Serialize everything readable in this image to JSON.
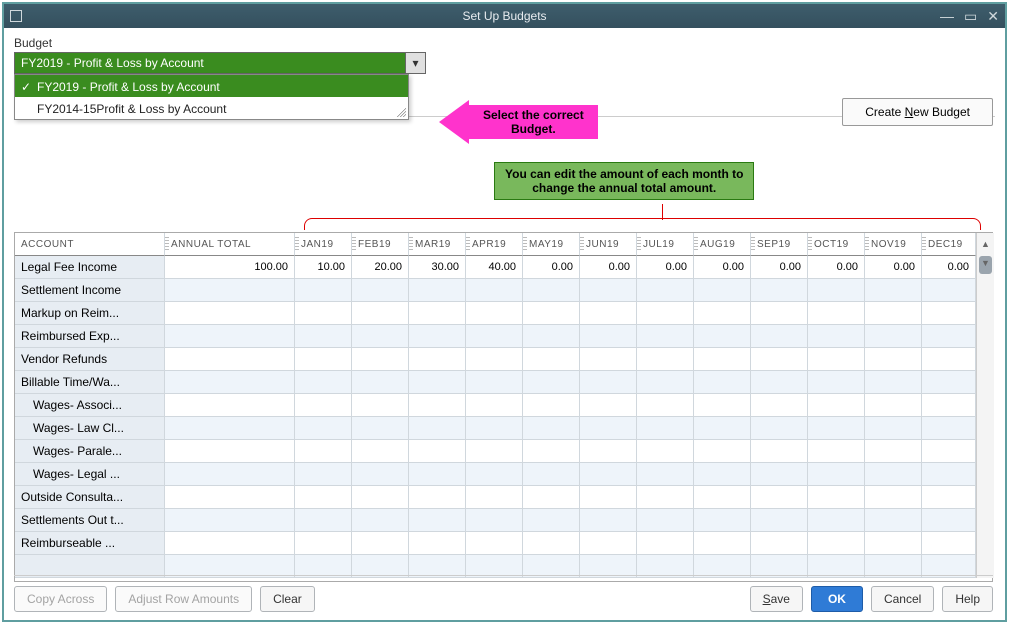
{
  "window": {
    "title": "Set Up Budgets"
  },
  "budget": {
    "label": "Budget",
    "selected": "FY2019 - Profit & Loss by Account",
    "options": [
      {
        "label": "FY2019 - Profit & Loss by Account",
        "selected": true
      },
      {
        "label": "FY2014-15Profit & Loss by Account",
        "selected": false
      }
    ]
  },
  "annotations": {
    "arrow_text": "Select the correct\nBudget.",
    "callout_text": "You can edit the amount of each month to\nchange the annual total amount."
  },
  "buttons": {
    "create_new_budget": "Create New Budget",
    "copy_across": "Copy Across",
    "adjust_row": "Adjust Row Amounts",
    "clear": "Clear",
    "save": "Save",
    "ok": "OK",
    "cancel": "Cancel",
    "help": "Help"
  },
  "grid": {
    "columns": [
      "ACCOUNT",
      "ANNUAL TOTAL",
      "JAN19",
      "FEB19",
      "MAR19",
      "APR19",
      "MAY19",
      "JUN19",
      "JUL19",
      "AUG19",
      "SEP19",
      "OCT19",
      "NOV19",
      "DEC19"
    ],
    "rows": [
      {
        "name": "Legal Fee Income",
        "annual": "100.00",
        "vals": [
          "10.00",
          "20.00",
          "30.00",
          "40.00",
          "0.00",
          "0.00",
          "0.00",
          "0.00",
          "0.00",
          "0.00",
          "0.00",
          "0.00"
        ],
        "sub": false
      },
      {
        "name": "Settlement Income",
        "annual": "",
        "vals": [
          "",
          "",
          "",
          "",
          "",
          "",
          "",
          "",
          "",
          "",
          "",
          ""
        ],
        "sub": false
      },
      {
        "name": "Markup on Reim...",
        "annual": "",
        "vals": [
          "",
          "",
          "",
          "",
          "",
          "",
          "",
          "",
          "",
          "",
          "",
          ""
        ],
        "sub": false
      },
      {
        "name": "Reimbursed Exp...",
        "annual": "",
        "vals": [
          "",
          "",
          "",
          "",
          "",
          "",
          "",
          "",
          "",
          "",
          "",
          ""
        ],
        "sub": false
      },
      {
        "name": "Vendor Refunds",
        "annual": "",
        "vals": [
          "",
          "",
          "",
          "",
          "",
          "",
          "",
          "",
          "",
          "",
          "",
          ""
        ],
        "sub": false
      },
      {
        "name": "Billable Time/Wa...",
        "annual": "",
        "vals": [
          "",
          "",
          "",
          "",
          "",
          "",
          "",
          "",
          "",
          "",
          "",
          ""
        ],
        "sub": false
      },
      {
        "name": "Wages- Associ...",
        "annual": "",
        "vals": [
          "",
          "",
          "",
          "",
          "",
          "",
          "",
          "",
          "",
          "",
          "",
          ""
        ],
        "sub": true
      },
      {
        "name": "Wages- Law Cl...",
        "annual": "",
        "vals": [
          "",
          "",
          "",
          "",
          "",
          "",
          "",
          "",
          "",
          "",
          "",
          ""
        ],
        "sub": true
      },
      {
        "name": "Wages- Parale...",
        "annual": "",
        "vals": [
          "",
          "",
          "",
          "",
          "",
          "",
          "",
          "",
          "",
          "",
          "",
          ""
        ],
        "sub": true
      },
      {
        "name": "Wages- Legal ...",
        "annual": "",
        "vals": [
          "",
          "",
          "",
          "",
          "",
          "",
          "",
          "",
          "",
          "",
          "",
          ""
        ],
        "sub": true
      },
      {
        "name": "Outside Consulta...",
        "annual": "",
        "vals": [
          "",
          "",
          "",
          "",
          "",
          "",
          "",
          "",
          "",
          "",
          "",
          ""
        ],
        "sub": false
      },
      {
        "name": "Settlements Out t...",
        "annual": "",
        "vals": [
          "",
          "",
          "",
          "",
          "",
          "",
          "",
          "",
          "",
          "",
          "",
          ""
        ],
        "sub": false
      },
      {
        "name": "Reimburseable ...",
        "annual": "",
        "vals": [
          "",
          "",
          "",
          "",
          "",
          "",
          "",
          "",
          "",
          "",
          "",
          ""
        ],
        "sub": false
      },
      {
        "name": "",
        "annual": "",
        "vals": [
          "",
          "",
          "",
          "",
          "",
          "",
          "",
          "",
          "",
          "",
          "",
          ""
        ],
        "sub": false
      }
    ]
  },
  "colors": {
    "titlebar": "#34505e",
    "dropdown_selected": "#3a8c1f",
    "arrow": "#ff33cc",
    "callout_bg": "#79b85c",
    "primary_btn": "#2f7bd6",
    "row_alt": "#eef4fa"
  }
}
